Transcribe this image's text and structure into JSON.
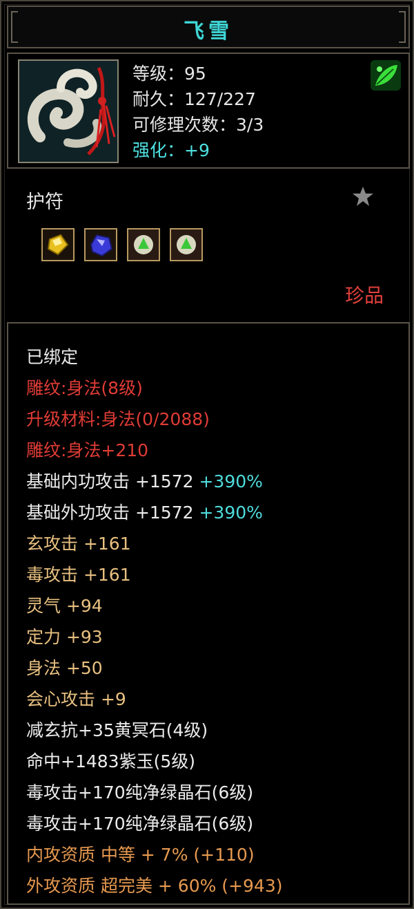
{
  "title": "飞雪",
  "header": {
    "level": "等级：95",
    "durability": "耐久：127/227",
    "repair": "可修理次数：3/3",
    "enhance": "强化：+9"
  },
  "item_type": "护符",
  "rarity": "珍品",
  "gems": [
    "yellow-gem-icon",
    "blue-gem-icon",
    "green-crystal-icon",
    "green-crystal-icon"
  ],
  "lines": {
    "bound": "已绑定",
    "engrave": "雕纹:身法(8级)",
    "upgrade_mat": "升级材料:身法(0/2088)",
    "engrave_bonus": "雕纹:身法+210",
    "inner_atk_label": "基础内功攻击 +1572 ",
    "inner_atk_pct": "+390%",
    "outer_atk_label": "基础外功攻击 +1572 ",
    "outer_atk_pct": "+390%",
    "xuan_atk": "玄攻击 +161",
    "poison_atk": "毒攻击 +161",
    "lingqi": "灵气 +94",
    "dingli": "定力 +93",
    "shenfa": "身法 +50",
    "crit": "会心攻击 +9",
    "gem1": "减玄抗+35黄冥石(4级)",
    "gem2": "命中+1483紫玉(5级)",
    "gem3": "毒攻击+170纯净绿晶石(6级)",
    "gem4": "毒攻击+170纯净绿晶石(6级)",
    "inner_quality": "内攻资质 中等 + 7% (+110)",
    "outer_quality": "外攻资质 超完美 + 60% (+943)"
  },
  "colors": {
    "title": "#3fd6d6",
    "red": "#e03c36",
    "gold": "#e8c080",
    "orange": "#e89a50",
    "cyan": "#4fdcdc"
  }
}
